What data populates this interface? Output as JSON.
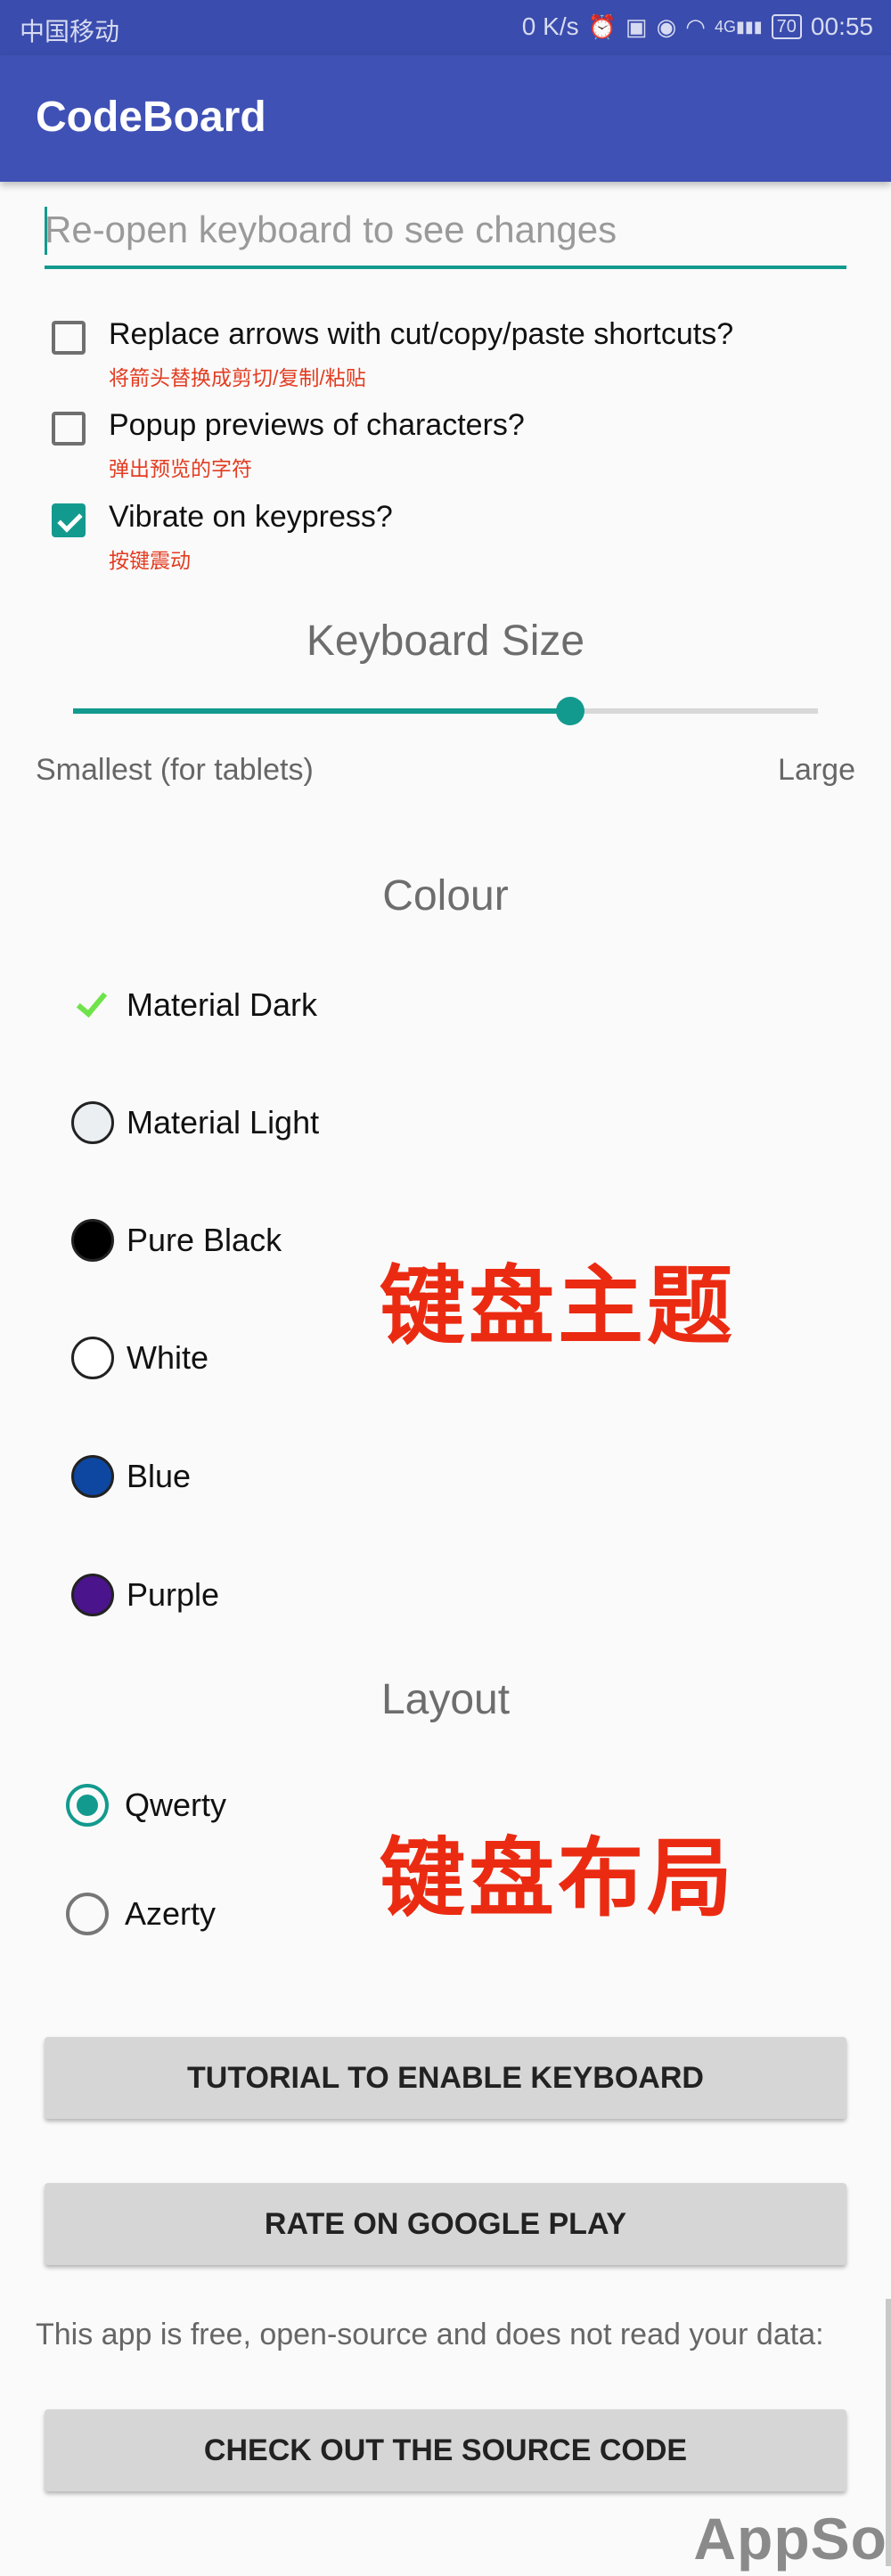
{
  "status_bar": {
    "carrier": "中国移动",
    "network_speed": "0 K/s",
    "icons": [
      "alarm-icon",
      "hd-icon",
      "eye-icon",
      "wifi-icon",
      "signal-icon"
    ],
    "signal_label": "4G",
    "battery": "70",
    "time": "00:55"
  },
  "app_bar": {
    "title": "CodeBoard"
  },
  "test_input": {
    "placeholder": "Re-open keyboard to see changes"
  },
  "options": [
    {
      "label": "Replace arrows with cut/copy/paste shortcuts?",
      "note": "将箭头替换成剪切/复制/粘贴",
      "checked": false
    },
    {
      "label": "Popup previews of characters?",
      "note": "弹出预览的字符",
      "checked": false
    },
    {
      "label": "Vibrate on keypress?",
      "note": "按键震动",
      "checked": true
    }
  ],
  "keyboard_size": {
    "title": "Keyboard Size",
    "min_label": "Smallest (for tablets)",
    "max_label": "Large",
    "value_fraction": 0.667
  },
  "colour": {
    "title": "Colour",
    "items": [
      {
        "label": "Material Dark",
        "selected": true,
        "color": "#6fe34a"
      },
      {
        "label": "Material Light",
        "selected": false,
        "color": "#eceff1"
      },
      {
        "label": "Pure Black",
        "selected": false,
        "color": "#000000"
      },
      {
        "label": "White",
        "selected": false,
        "color": "#ffffff"
      },
      {
        "label": "Blue",
        "selected": false,
        "color": "#0d47a1"
      },
      {
        "label": "Purple",
        "selected": false,
        "color": "#4a148c"
      }
    ],
    "annotation": "键盘主题"
  },
  "layout": {
    "title": "Layout",
    "items": [
      {
        "label": "Qwerty",
        "selected": true
      },
      {
        "label": "Azerty",
        "selected": false
      }
    ],
    "annotation": "键盘布局"
  },
  "buttons": {
    "tutorial": "TUTORIAL TO ENABLE KEYBOARD",
    "rate": "RATE ON GOOGLE PLAY",
    "source": "CHECK OUT THE SOURCE CODE"
  },
  "about_text": "This app is free, open-source and does not read your data:",
  "watermark": "AppSo",
  "colors": {
    "accent": "#139a8e",
    "primary": "#3f51b5",
    "annotation": "#ea2b12"
  }
}
